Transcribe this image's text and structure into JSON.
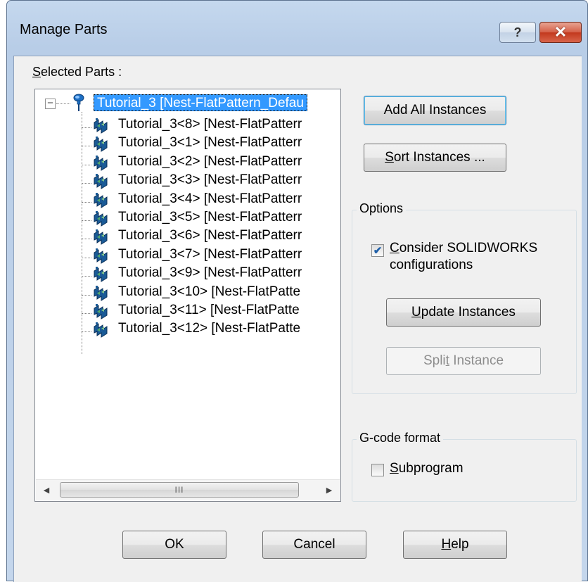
{
  "window": {
    "title": "Manage Parts",
    "help_glyph": "?",
    "close_glyph": "✕"
  },
  "selected_parts": {
    "label_mnemonic": "S",
    "label_rest": "elected Parts :",
    "root": {
      "expander": "⊟",
      "icon": "pin-icon",
      "label": "Tutorial_3 [Nest-FlatPattern_Defau"
    },
    "children": [
      "Tutorial_3<8> [Nest-FlatPatterr",
      "Tutorial_3<1> [Nest-FlatPatterr",
      "Tutorial_3<2> [Nest-FlatPatterr",
      "Tutorial_3<3> [Nest-FlatPatterr",
      "Tutorial_3<4> [Nest-FlatPatterr",
      "Tutorial_3<5> [Nest-FlatPatterr",
      "Tutorial_3<6> [Nest-FlatPatterr",
      "Tutorial_3<7> [Nest-FlatPatterr",
      "Tutorial_3<9> [Nest-FlatPatterr",
      "Tutorial_3<10> [Nest-FlatPatte",
      "Tutorial_3<11> [Nest-FlatPatte",
      "Tutorial_3<12> [Nest-FlatPatte"
    ],
    "child_icon": "part-instance-icon",
    "scroll_left": "◀",
    "scroll_right": "▶",
    "scroll_grip": "III"
  },
  "buttons": {
    "add_all": "Add All Instances",
    "sort_mnemonic": "S",
    "sort_rest": "ort Instances ...",
    "update_mnemonic": "U",
    "update_rest": "pdate Instances",
    "split_pre": "Spli",
    "split_mnemonic": "t",
    "split_rest": " Instance",
    "ok": "OK",
    "cancel": "Cancel",
    "help_mnemonic": "H",
    "help_rest": "elp"
  },
  "options": {
    "legend": "Options",
    "consider_checked": true,
    "consider_mnemonic": "C",
    "consider_line1_rest": "onsider SOLIDWORKS",
    "consider_line2": "configurations",
    "check_glyph": "✔"
  },
  "gcode": {
    "legend": "G-code format",
    "subprogram_checked": false,
    "subprogram_mnemonic": "S",
    "subprogram_rest": "ubprogram"
  },
  "colors": {
    "selection": "#3399ff",
    "dialog_bg": "#f0f0f0",
    "close_red": "#c2381d"
  }
}
